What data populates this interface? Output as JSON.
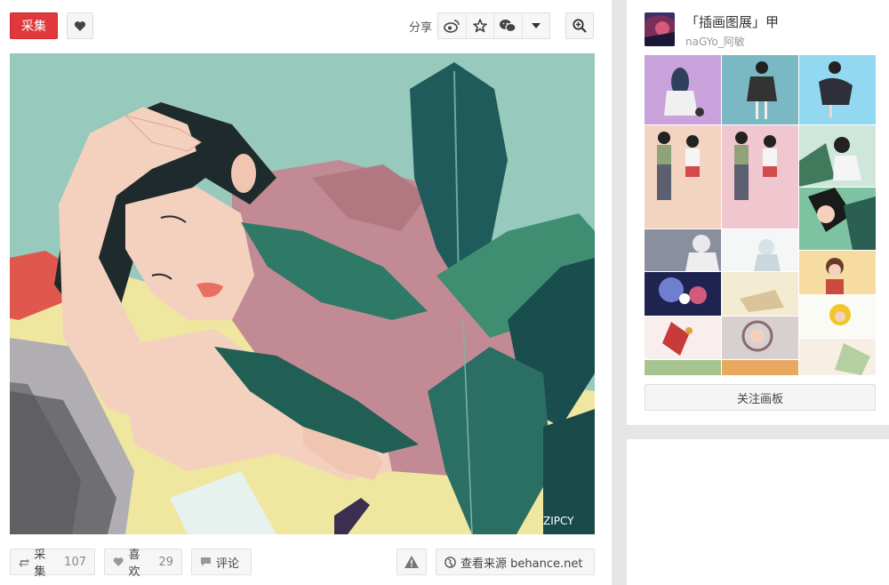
{
  "toolbar": {
    "collect_label": "采集",
    "share_label": "分享",
    "share_items": [
      "weibo-icon",
      "star-icon",
      "wechat-icon",
      "chevron-down-icon"
    ]
  },
  "artwork": {
    "signature": "ZIPCY"
  },
  "actions": {
    "collect_label": "采集",
    "collect_count": "107",
    "like_label": "喜欢",
    "like_count": "29",
    "comment_label": "评论",
    "source_label": "查看来源 behance.net"
  },
  "board": {
    "title": "「插画图展」甲",
    "user": "naGYo_阿敏",
    "follow_label": "关注画板"
  },
  "colors": {
    "accent": "#e0383c",
    "artwork_bg": "#98c9bd"
  }
}
